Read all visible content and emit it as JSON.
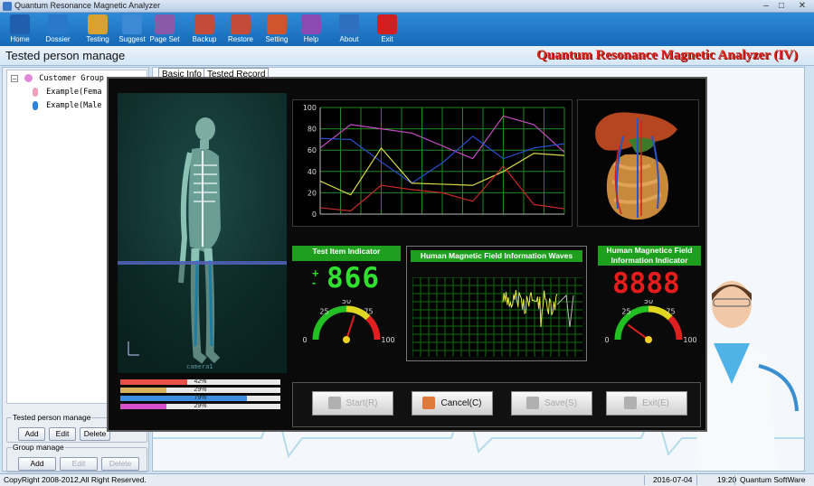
{
  "app": {
    "window_title": "Quantum Resonance Magnetic Analyzer"
  },
  "toolbar": [
    {
      "label": "Home",
      "icon": "home-icon",
      "color": "#1f5fae"
    },
    {
      "label": "Dossier",
      "icon": "folder-icon",
      "color": "#2a79c9"
    },
    {
      "label": "Testing",
      "icon": "hand-icon",
      "color": "#d9a032"
    },
    {
      "label": "Suggest",
      "icon": "people-icon",
      "color": "#3c8ad6"
    },
    {
      "label": "Page Set",
      "icon": "page-setup-icon",
      "color": "#8a5aa8"
    },
    {
      "label": "Backup",
      "icon": "backup-icon",
      "color": "#c24b3a"
    },
    {
      "label": "Restore",
      "icon": "restore-icon",
      "color": "#c24b3a"
    },
    {
      "label": "Setting",
      "icon": "setting-icon",
      "color": "#d0542e"
    },
    {
      "label": "Help",
      "icon": "help-icon",
      "color": "#8b4ab0"
    },
    {
      "label": "About",
      "icon": "about-icon",
      "color": "#2f6fbf"
    },
    {
      "label": "Exit",
      "icon": "power-icon",
      "color": "#d11f1f"
    }
  ],
  "header": {
    "title": "Tested person manage",
    "brand": "Quantum Resonance Magnetic Analyzer (IV)"
  },
  "tree": {
    "root": "Customer Group",
    "items": [
      "Example(Fema",
      "Example(Male"
    ]
  },
  "tabs": [
    "Basic Info",
    "Tested Record"
  ],
  "tested_person_manage": {
    "caption": "Tested person manage",
    "add": "Add",
    "edit": "Edit",
    "delete": "Delete"
  },
  "group_manage": {
    "caption": "Group manage",
    "add": "Add",
    "edit": "Edit",
    "delete": "Delete"
  },
  "status": {
    "copyright": "CopyRight 2008-2012,All Right Reserved.",
    "date": "2016-07-04",
    "time": "19:20",
    "vendor": "Quantum SoftWare"
  },
  "analysis": {
    "body_label": "camera1",
    "progress": [
      {
        "text": "42%",
        "value": 0.42,
        "color": "#e8504a"
      },
      {
        "text": "29%",
        "value": 0.29,
        "color": "#d7b25a"
      },
      {
        "text": "79%",
        "value": 0.79,
        "color": "#3d8ee0"
      },
      {
        "text": "29%",
        "value": 0.29,
        "color": "#d64fc9"
      }
    ],
    "test_item": {
      "label": "Test Item Indicator",
      "sign_plus": "+",
      "sign_minus": "-",
      "value": "866",
      "gauge_ticks": [
        "0",
        "25",
        "50",
        "75",
        "100"
      ],
      "gauge_value": 60
    },
    "waves": {
      "label": "Human Magnetic  Field Information Waves"
    },
    "field_indicator": {
      "label": "Human Magnetice Field Information Indicator",
      "value": "8888",
      "gauge_ticks": [
        "0",
        "25",
        "50",
        "75",
        "100"
      ],
      "gauge_value": 20
    },
    "buttons": {
      "start": "Start(R)",
      "cancel": "Cancel(C)",
      "save": "Save(S)",
      "exit": "Exit(E)"
    }
  },
  "chart_data": {
    "type": "line",
    "x": [
      0,
      1,
      2,
      3,
      4,
      5,
      6,
      7,
      8
    ],
    "ylim": [
      0,
      100
    ],
    "yticks": [
      0,
      20,
      40,
      60,
      80,
      100
    ],
    "grid": true,
    "series": [
      {
        "color": "#c24bc4",
        "values": [
          62,
          84,
          80,
          76,
          64,
          52,
          92,
          84,
          58
        ]
      },
      {
        "color": "#2a4fd2",
        "values": [
          71,
          70,
          49,
          29,
          48,
          73,
          52,
          62,
          66
        ]
      },
      {
        "color": "#d9d94a",
        "values": [
          31,
          18,
          62,
          29,
          28,
          27,
          40,
          57,
          55
        ]
      },
      {
        "color": "#c62a2a",
        "values": [
          6,
          3,
          27,
          23,
          20,
          12,
          45,
          9,
          5
        ]
      }
    ]
  },
  "colors": {
    "toolbar": "#1f7ccb",
    "brand": "#e0251b",
    "digits_green": "#2fe02f",
    "digits_red": "#e81c1c",
    "wave": "#e6e64c"
  }
}
